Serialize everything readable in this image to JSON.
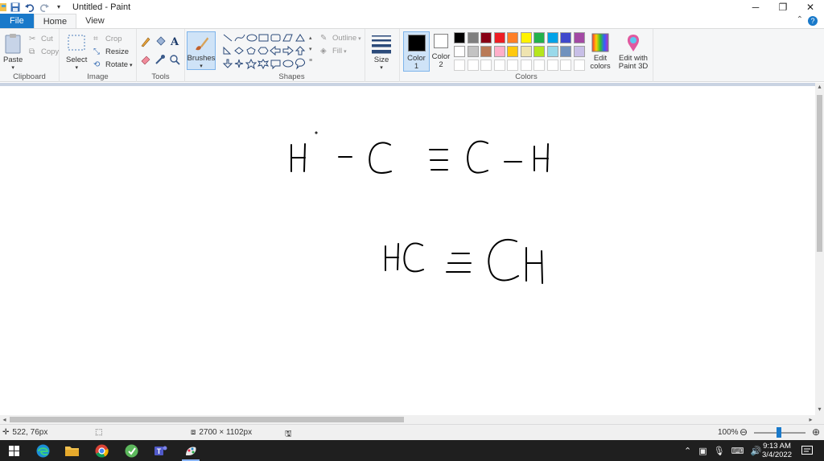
{
  "window": {
    "title": "Untitled - Paint"
  },
  "tabs": [
    {
      "label": "File"
    },
    {
      "label": "Home"
    },
    {
      "label": "View"
    }
  ],
  "ribbon": {
    "clipboard": {
      "label": "Clipboard",
      "paste": "Paste",
      "cut": "Cut",
      "copy": "Copy"
    },
    "image": {
      "label": "Image",
      "select": "Select",
      "crop": "Crop",
      "resize": "Resize",
      "rotate": "Rotate"
    },
    "tools": {
      "label": "Tools"
    },
    "brushes": {
      "label": "Brushes"
    },
    "shapes": {
      "label": "Shapes",
      "outline": "Outline",
      "fill": "Fill"
    },
    "size": {
      "label": "Size"
    },
    "colors": {
      "label": "Colors",
      "color1": "Color 1",
      "color2": "Color 2",
      "edit_colors": "Edit colors",
      "edit_paint3d": "Edit with Paint 3D",
      "palette_row1": [
        "#000000",
        "#7f7f7f",
        "#880015",
        "#ed1c24",
        "#ff7f27",
        "#fff200",
        "#22b14c",
        "#00a2e8",
        "#3f48cc",
        "#a349a4"
      ],
      "palette_row2": [
        "#ffffff",
        "#c3c3c3",
        "#b97a57",
        "#ffaec9",
        "#ffc90e",
        "#efe4b0",
        "#b5e61d",
        "#99d9ea",
        "#7092be",
        "#c8bfe7"
      ],
      "color1_value": "#000000",
      "color2_value": "#ffffff"
    }
  },
  "status": {
    "cursor_pos": "522, 76px",
    "canvas_size": "2700 × 1102px",
    "zoom": "100%"
  },
  "taskbar": {
    "time": "9:13 AM",
    "date": "3/4/2022"
  }
}
